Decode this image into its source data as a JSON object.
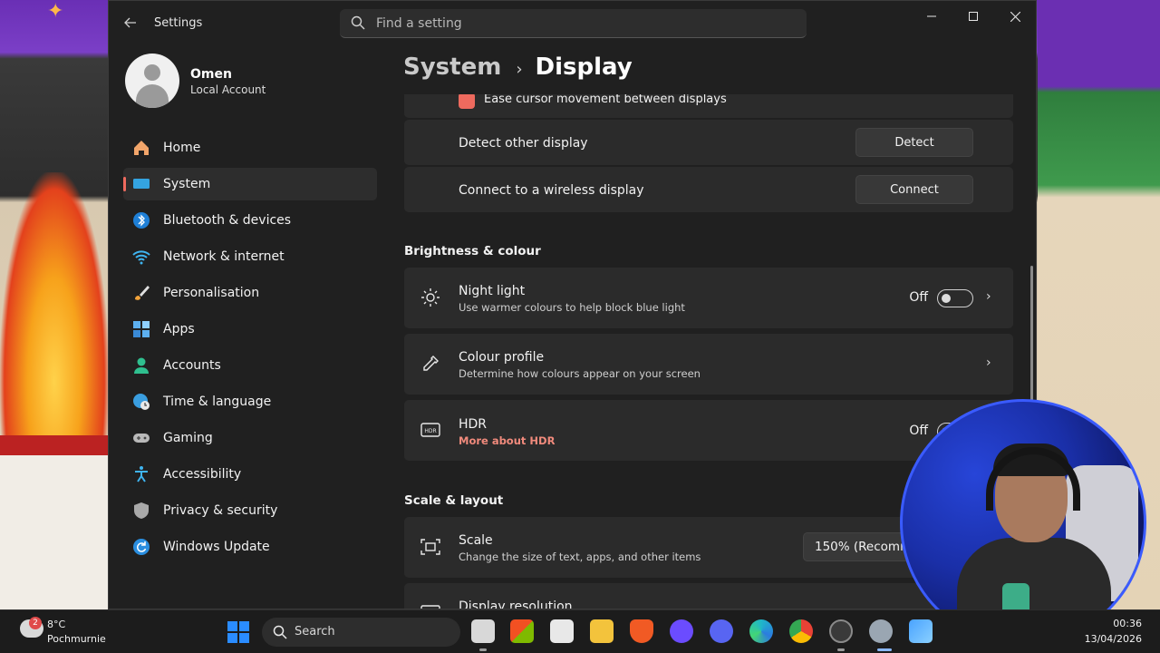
{
  "window": {
    "title": "Settings",
    "search_placeholder": "Find a setting"
  },
  "profile": {
    "name": "Omen",
    "account_type": "Local Account"
  },
  "nav": {
    "items": [
      {
        "label": "Home",
        "icon": "home-icon",
        "active": false
      },
      {
        "label": "System",
        "icon": "system-icon",
        "active": true
      },
      {
        "label": "Bluetooth & devices",
        "icon": "bluetooth-icon",
        "active": false
      },
      {
        "label": "Network & internet",
        "icon": "wifi-icon",
        "active": false
      },
      {
        "label": "Personalisation",
        "icon": "brush-icon",
        "active": false
      },
      {
        "label": "Apps",
        "icon": "apps-icon",
        "active": false
      },
      {
        "label": "Accounts",
        "icon": "accounts-icon",
        "active": false
      },
      {
        "label": "Time & language",
        "icon": "globe-clock-icon",
        "active": false
      },
      {
        "label": "Gaming",
        "icon": "gamepad-icon",
        "active": false
      },
      {
        "label": "Accessibility",
        "icon": "accessibility-icon",
        "active": false
      },
      {
        "label": "Privacy & security",
        "icon": "shield-icon",
        "active": false
      },
      {
        "label": "Windows Update",
        "icon": "update-icon",
        "active": false
      }
    ]
  },
  "breadcrumb": {
    "parent": "System",
    "current": "Display"
  },
  "content": {
    "ease_cursor_label": "Ease cursor movement between displays",
    "detect": {
      "label": "Detect other display",
      "button": "Detect"
    },
    "wireless": {
      "label": "Connect to a wireless display",
      "button": "Connect"
    },
    "brightness_section": "Brightness & colour",
    "night_light": {
      "title": "Night light",
      "subtitle": "Use warmer colours to help block blue light",
      "state": "Off"
    },
    "colour_profile": {
      "title": "Colour profile",
      "subtitle": "Determine how colours appear on your screen"
    },
    "hdr": {
      "title": "HDR",
      "link": "More about HDR",
      "state": "Off"
    },
    "scale_section": "Scale & layout",
    "scale": {
      "title": "Scale",
      "subtitle": "Change the size of text, apps, and other items",
      "value": "150% (Recommended)"
    },
    "resolution": {
      "title": "Display resolution"
    }
  },
  "taskbar": {
    "weather_badge": "2",
    "weather_temp": "8°C",
    "weather_desc": "Pochmurnie",
    "search_label": "Search",
    "time": "00:36",
    "date": "13/04/2026",
    "apps": [
      {
        "name": "file-explorer-blank-icon",
        "color": "#d8d8d8"
      },
      {
        "name": "store-icon",
        "color": "#f2a33a"
      },
      {
        "name": "office-icon",
        "color": "#e8e8e8"
      },
      {
        "name": "folder-icon",
        "color": "#f3c33c"
      },
      {
        "name": "brave-icon",
        "color": "#f15a24"
      },
      {
        "name": "obs-icon",
        "color": "#6b4cff"
      },
      {
        "name": "discord-icon",
        "color": "#5865f2"
      },
      {
        "name": "edge-icon",
        "color": "#1fb6c9"
      },
      {
        "name": "chrome-icon",
        "color": "#e8b53a"
      },
      {
        "name": "steam-like-icon",
        "color": "#8a8a8a"
      },
      {
        "name": "settings-icon",
        "color": "#9aa6b2"
      },
      {
        "name": "photos-icon",
        "color": "#4aa3ff"
      }
    ]
  },
  "colors": {
    "accent": "#ee6a5e",
    "window_bg": "#202020",
    "card_bg": "#2b2b2b"
  }
}
